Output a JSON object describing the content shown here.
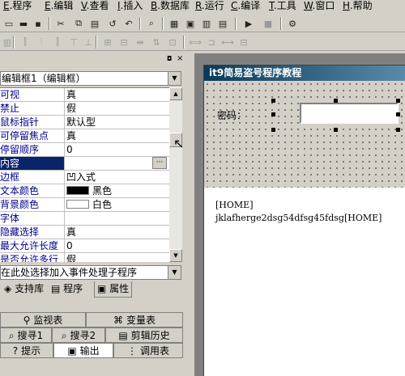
{
  "menu": {
    "items": [
      {
        "key": "E",
        "label": ".程序"
      },
      {
        "key": "E",
        "label": ".编辑"
      },
      {
        "key": "V",
        "label": ".查看"
      },
      {
        "key": "I",
        "label": ".插入"
      },
      {
        "key": "B",
        "label": ".数据库"
      },
      {
        "key": "R",
        "label": ".运行"
      },
      {
        "key": "C",
        "label": ".编译"
      },
      {
        "key": "T",
        "label": ".工具"
      },
      {
        "key": "W",
        "label": ".窗口"
      },
      {
        "key": "H",
        "label": ".帮助"
      }
    ]
  },
  "properties": {
    "component_label": "编辑框1（编辑框）",
    "rows": [
      {
        "name": "可视",
        "value": "真"
      },
      {
        "name": "禁止",
        "value": "假"
      },
      {
        "name": "鼠标指针",
        "value": "默认型"
      },
      {
        "name": "可停留焦点",
        "value": "真"
      },
      {
        "name": "  停留顺序",
        "value": "0"
      },
      {
        "name": "内容",
        "value": ""
      },
      {
        "name": "边框",
        "value": "凹入式"
      },
      {
        "name": "文本颜色",
        "value": "黑色",
        "swatch": "#000000"
      },
      {
        "name": "背景颜色",
        "value": "白色",
        "swatch": "#ffffff"
      },
      {
        "name": "字体",
        "value": ""
      },
      {
        "name": "隐藏选择",
        "value": "真"
      },
      {
        "name": "最大允许长度",
        "value": "0"
      },
      {
        "name": "是否允许多行",
        "value": "假"
      }
    ],
    "event_placeholder": "在此处选择加入事件处理子程序",
    "tabs": [
      "支持库",
      "程序",
      "属性"
    ],
    "selected_row": 5
  },
  "bottom_tabs": {
    "row1": [
      "监视表",
      "变量表"
    ],
    "row2": [
      "搜寻1",
      "搜寻2",
      "剪辑历史"
    ],
    "row3": [
      "提示",
      "输出",
      "调用表"
    ]
  },
  "designer": {
    "window_title": "it9简易盗号程序教程",
    "password_label": "密码：",
    "output_lines": [
      "[HOME]",
      "jklafherge2dsg54dfsg45fdsg[HOME]"
    ]
  },
  "colors": {
    "title_start": "#0a3a5a",
    "title_end": "#5a8aa8",
    "selection": "#0a246a"
  }
}
